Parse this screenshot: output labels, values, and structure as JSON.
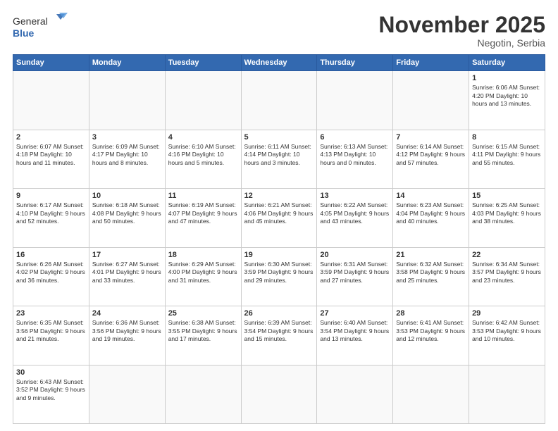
{
  "header": {
    "logo_general": "General",
    "logo_blue": "Blue",
    "month_title": "November 2025",
    "location": "Negotin, Serbia"
  },
  "weekdays": [
    "Sunday",
    "Monday",
    "Tuesday",
    "Wednesday",
    "Thursday",
    "Friday",
    "Saturday"
  ],
  "weeks": [
    [
      {
        "day": "",
        "info": ""
      },
      {
        "day": "",
        "info": ""
      },
      {
        "day": "",
        "info": ""
      },
      {
        "day": "",
        "info": ""
      },
      {
        "day": "",
        "info": ""
      },
      {
        "day": "",
        "info": ""
      },
      {
        "day": "1",
        "info": "Sunrise: 6:06 AM\nSunset: 4:20 PM\nDaylight: 10 hours and 13 minutes."
      }
    ],
    [
      {
        "day": "2",
        "info": "Sunrise: 6:07 AM\nSunset: 4:18 PM\nDaylight: 10 hours and 11 minutes."
      },
      {
        "day": "3",
        "info": "Sunrise: 6:09 AM\nSunset: 4:17 PM\nDaylight: 10 hours and 8 minutes."
      },
      {
        "day": "4",
        "info": "Sunrise: 6:10 AM\nSunset: 4:16 PM\nDaylight: 10 hours and 5 minutes."
      },
      {
        "day": "5",
        "info": "Sunrise: 6:11 AM\nSunset: 4:14 PM\nDaylight: 10 hours and 3 minutes."
      },
      {
        "day": "6",
        "info": "Sunrise: 6:13 AM\nSunset: 4:13 PM\nDaylight: 10 hours and 0 minutes."
      },
      {
        "day": "7",
        "info": "Sunrise: 6:14 AM\nSunset: 4:12 PM\nDaylight: 9 hours and 57 minutes."
      },
      {
        "day": "8",
        "info": "Sunrise: 6:15 AM\nSunset: 4:11 PM\nDaylight: 9 hours and 55 minutes."
      }
    ],
    [
      {
        "day": "9",
        "info": "Sunrise: 6:17 AM\nSunset: 4:10 PM\nDaylight: 9 hours and 52 minutes."
      },
      {
        "day": "10",
        "info": "Sunrise: 6:18 AM\nSunset: 4:08 PM\nDaylight: 9 hours and 50 minutes."
      },
      {
        "day": "11",
        "info": "Sunrise: 6:19 AM\nSunset: 4:07 PM\nDaylight: 9 hours and 47 minutes."
      },
      {
        "day": "12",
        "info": "Sunrise: 6:21 AM\nSunset: 4:06 PM\nDaylight: 9 hours and 45 minutes."
      },
      {
        "day": "13",
        "info": "Sunrise: 6:22 AM\nSunset: 4:05 PM\nDaylight: 9 hours and 43 minutes."
      },
      {
        "day": "14",
        "info": "Sunrise: 6:23 AM\nSunset: 4:04 PM\nDaylight: 9 hours and 40 minutes."
      },
      {
        "day": "15",
        "info": "Sunrise: 6:25 AM\nSunset: 4:03 PM\nDaylight: 9 hours and 38 minutes."
      }
    ],
    [
      {
        "day": "16",
        "info": "Sunrise: 6:26 AM\nSunset: 4:02 PM\nDaylight: 9 hours and 36 minutes."
      },
      {
        "day": "17",
        "info": "Sunrise: 6:27 AM\nSunset: 4:01 PM\nDaylight: 9 hours and 33 minutes."
      },
      {
        "day": "18",
        "info": "Sunrise: 6:29 AM\nSunset: 4:00 PM\nDaylight: 9 hours and 31 minutes."
      },
      {
        "day": "19",
        "info": "Sunrise: 6:30 AM\nSunset: 3:59 PM\nDaylight: 9 hours and 29 minutes."
      },
      {
        "day": "20",
        "info": "Sunrise: 6:31 AM\nSunset: 3:59 PM\nDaylight: 9 hours and 27 minutes."
      },
      {
        "day": "21",
        "info": "Sunrise: 6:32 AM\nSunset: 3:58 PM\nDaylight: 9 hours and 25 minutes."
      },
      {
        "day": "22",
        "info": "Sunrise: 6:34 AM\nSunset: 3:57 PM\nDaylight: 9 hours and 23 minutes."
      }
    ],
    [
      {
        "day": "23",
        "info": "Sunrise: 6:35 AM\nSunset: 3:56 PM\nDaylight: 9 hours and 21 minutes."
      },
      {
        "day": "24",
        "info": "Sunrise: 6:36 AM\nSunset: 3:56 PM\nDaylight: 9 hours and 19 minutes."
      },
      {
        "day": "25",
        "info": "Sunrise: 6:38 AM\nSunset: 3:55 PM\nDaylight: 9 hours and 17 minutes."
      },
      {
        "day": "26",
        "info": "Sunrise: 6:39 AM\nSunset: 3:54 PM\nDaylight: 9 hours and 15 minutes."
      },
      {
        "day": "27",
        "info": "Sunrise: 6:40 AM\nSunset: 3:54 PM\nDaylight: 9 hours and 13 minutes."
      },
      {
        "day": "28",
        "info": "Sunrise: 6:41 AM\nSunset: 3:53 PM\nDaylight: 9 hours and 12 minutes."
      },
      {
        "day": "29",
        "info": "Sunrise: 6:42 AM\nSunset: 3:53 PM\nDaylight: 9 hours and 10 minutes."
      }
    ],
    [
      {
        "day": "30",
        "info": "Sunrise: 6:43 AM\nSunset: 3:52 PM\nDaylight: 9 hours and 9 minutes."
      },
      {
        "day": "",
        "info": ""
      },
      {
        "day": "",
        "info": ""
      },
      {
        "day": "",
        "info": ""
      },
      {
        "day": "",
        "info": ""
      },
      {
        "day": "",
        "info": ""
      },
      {
        "day": "",
        "info": ""
      }
    ]
  ]
}
